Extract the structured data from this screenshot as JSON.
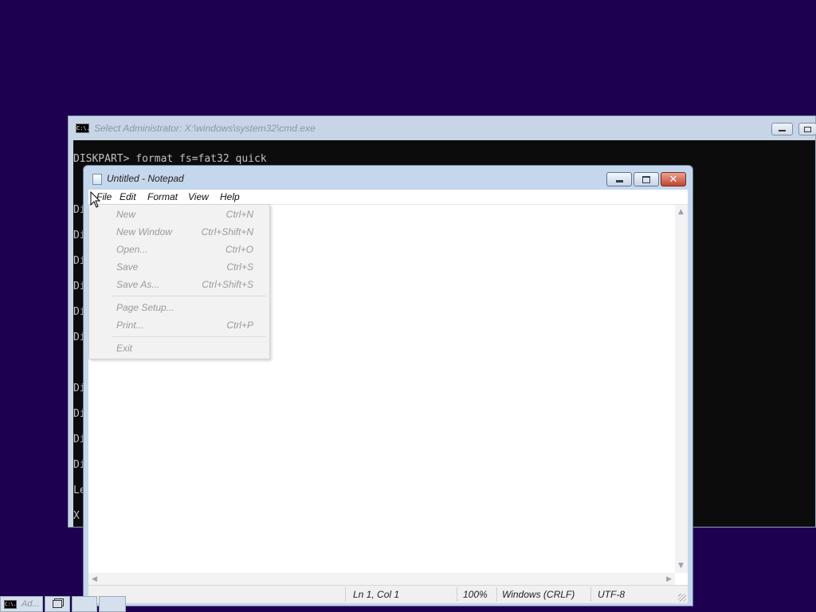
{
  "cmd": {
    "title": "Select Administrator: X:\\windows\\system32\\cmd.exe",
    "icon_text": "C:\\.",
    "lines": [
      {
        "text": "DISKPART> format fs=fat32 quick"
      },
      {
        "text": "Di"
      },
      {
        "text": "Di"
      },
      {
        "text": "Di"
      },
      {
        "text": "Di"
      },
      {
        "text": "Di"
      },
      {
        "text": "Di"
      },
      {
        "text": "Di"
      },
      {
        "text": "Di"
      },
      {
        "text": "Di"
      },
      {
        "text": "Di"
      },
      {
        "text": "Le"
      },
      {
        "text": "X"
      }
    ]
  },
  "notepad": {
    "title": "Untitled - Notepad",
    "close_glyph": "✕",
    "menu": [
      "File",
      "Edit",
      "Format",
      "View",
      "Help"
    ],
    "status": {
      "position": "Ln 1, Col 1",
      "zoom": "100%",
      "line_ending": "Windows (CRLF)",
      "encoding": "UTF-8"
    }
  },
  "file_menu": {
    "items": [
      {
        "label": "New",
        "shortcut": "Ctrl+N"
      },
      {
        "label": "New Window",
        "shortcut": "Ctrl+Shift+N"
      },
      {
        "label": "Open...",
        "shortcut": "Ctrl+O"
      },
      {
        "label": "Save",
        "shortcut": "Ctrl+S"
      },
      {
        "label": "Save As...",
        "shortcut": "Ctrl+Shift+S"
      },
      {
        "label": "Page Setup...",
        "shortcut": ""
      },
      {
        "label": "Print...",
        "shortcut": "Ctrl+P"
      },
      {
        "label": "Exit",
        "shortcut": ""
      }
    ]
  },
  "scroll": {
    "up": "▲",
    "down": "▼",
    "left": "◀",
    "right": "▶"
  },
  "taskbar": {
    "cmd_label": "Ad..."
  },
  "colors": {
    "desktop": "#1e0050",
    "console_bg": "#0c0c0c",
    "console_text": "#c0c0c0"
  }
}
